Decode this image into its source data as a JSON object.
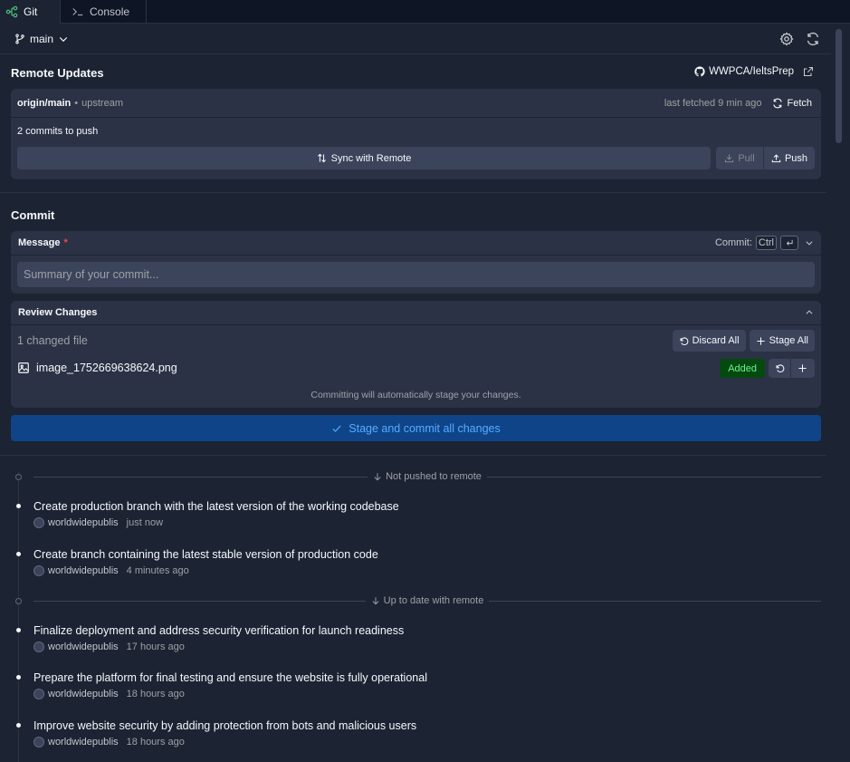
{
  "tabs": [
    {
      "label": "Git",
      "icon": "git-icon",
      "active": true
    },
    {
      "label": "Console",
      "icon": "terminal-icon",
      "active": false
    }
  ],
  "branch": {
    "name": "main"
  },
  "remote": {
    "title": "Remote Updates",
    "repo": "WWPCA/IeltsPrep",
    "branch_ref": "origin/main",
    "upstream_label": "upstream",
    "last_fetched": "last fetched 9 min ago",
    "fetch_label": "Fetch",
    "push_count": "2 commits to push",
    "sync_label": "Sync with Remote",
    "pull_label": "Pull",
    "push_label": "Push"
  },
  "commit": {
    "title": "Commit",
    "message_label": "Message",
    "required_mark": "*",
    "shortcut_prefix": "Commit:",
    "shortcut_key": "Ctrl",
    "placeholder": "Summary of your commit...",
    "review_title": "Review Changes",
    "changed_count": "1 changed file",
    "discard_all": "Discard All",
    "stage_all": "Stage All",
    "file_name": "image_1752669638624.png",
    "file_status": "Added",
    "auto_stage_note": "Committing will automatically stage your changes.",
    "commit_button": "Stage and commit all changes"
  },
  "history": {
    "not_pushed_label": "Not pushed to remote",
    "up_to_date_label": "Up to date with remote",
    "unpushed": [
      {
        "title": "Create production branch with the latest version of the working codebase",
        "author": "worldwidepublis",
        "when": "just now"
      },
      {
        "title": "Create branch containing the latest stable version of production code",
        "author": "worldwidepublis",
        "when": "4 minutes ago"
      }
    ],
    "pushed": [
      {
        "title": "Finalize deployment and address security verification for launch readiness",
        "author": "worldwidepublis",
        "when": "17 hours ago"
      },
      {
        "title": "Prepare the platform for final testing and ensure the website is fully operational",
        "author": "worldwidepublis",
        "when": "18 hours ago"
      },
      {
        "title": "Improve website security by adding protection from bots and malicious users",
        "author": "worldwidepublis",
        "when": "18 hours ago"
      }
    ]
  },
  "colors": {
    "background": "#1c2333",
    "surface": "#2b3245",
    "button": "#3c445c",
    "primary": "#0f4488",
    "primary_text": "#57abff",
    "added_bg": "#044a10",
    "added_text": "#6ef08e",
    "required": "#f44747"
  }
}
